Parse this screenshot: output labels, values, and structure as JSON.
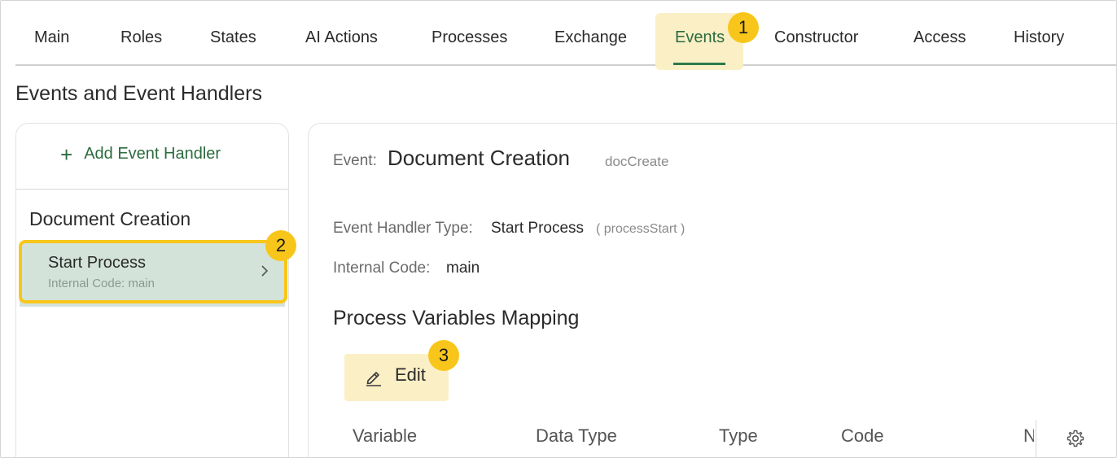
{
  "tabs": [
    {
      "label": "Main"
    },
    {
      "label": "Roles"
    },
    {
      "label": "States"
    },
    {
      "label": "AI Actions"
    },
    {
      "label": "Processes"
    },
    {
      "label": "Exchange"
    },
    {
      "label": "Events"
    },
    {
      "label": "Constructor"
    },
    {
      "label": "Access"
    },
    {
      "label": "History"
    }
  ],
  "active_tab": "Events",
  "badges": {
    "b1": "1",
    "b2": "2",
    "b3": "3"
  },
  "page_title": "Events and Event Handlers",
  "left_panel": {
    "add_label": "Add Event Handler",
    "group_title": "Document Creation",
    "item": {
      "title": "Start Process",
      "subtitle": "Internal Code: main"
    }
  },
  "event": {
    "label": "Event:",
    "name": "Document Creation",
    "code": "docCreate",
    "handler_type_label": "Event Handler Type:",
    "handler_type_value": "Start Process",
    "handler_type_code": "( processStart )",
    "internal_code_label": "Internal Code:",
    "internal_code_value": "main"
  },
  "mapping": {
    "title": "Process Variables Mapping",
    "edit_label": "Edit",
    "columns": [
      "Variable",
      "Data Type",
      "Type",
      "Code",
      "N"
    ]
  },
  "colors": {
    "accent": "#2c6b3f",
    "highlight": "#fbefc6",
    "badge": "#f8c61a",
    "selected_item": "#d3e3da"
  }
}
